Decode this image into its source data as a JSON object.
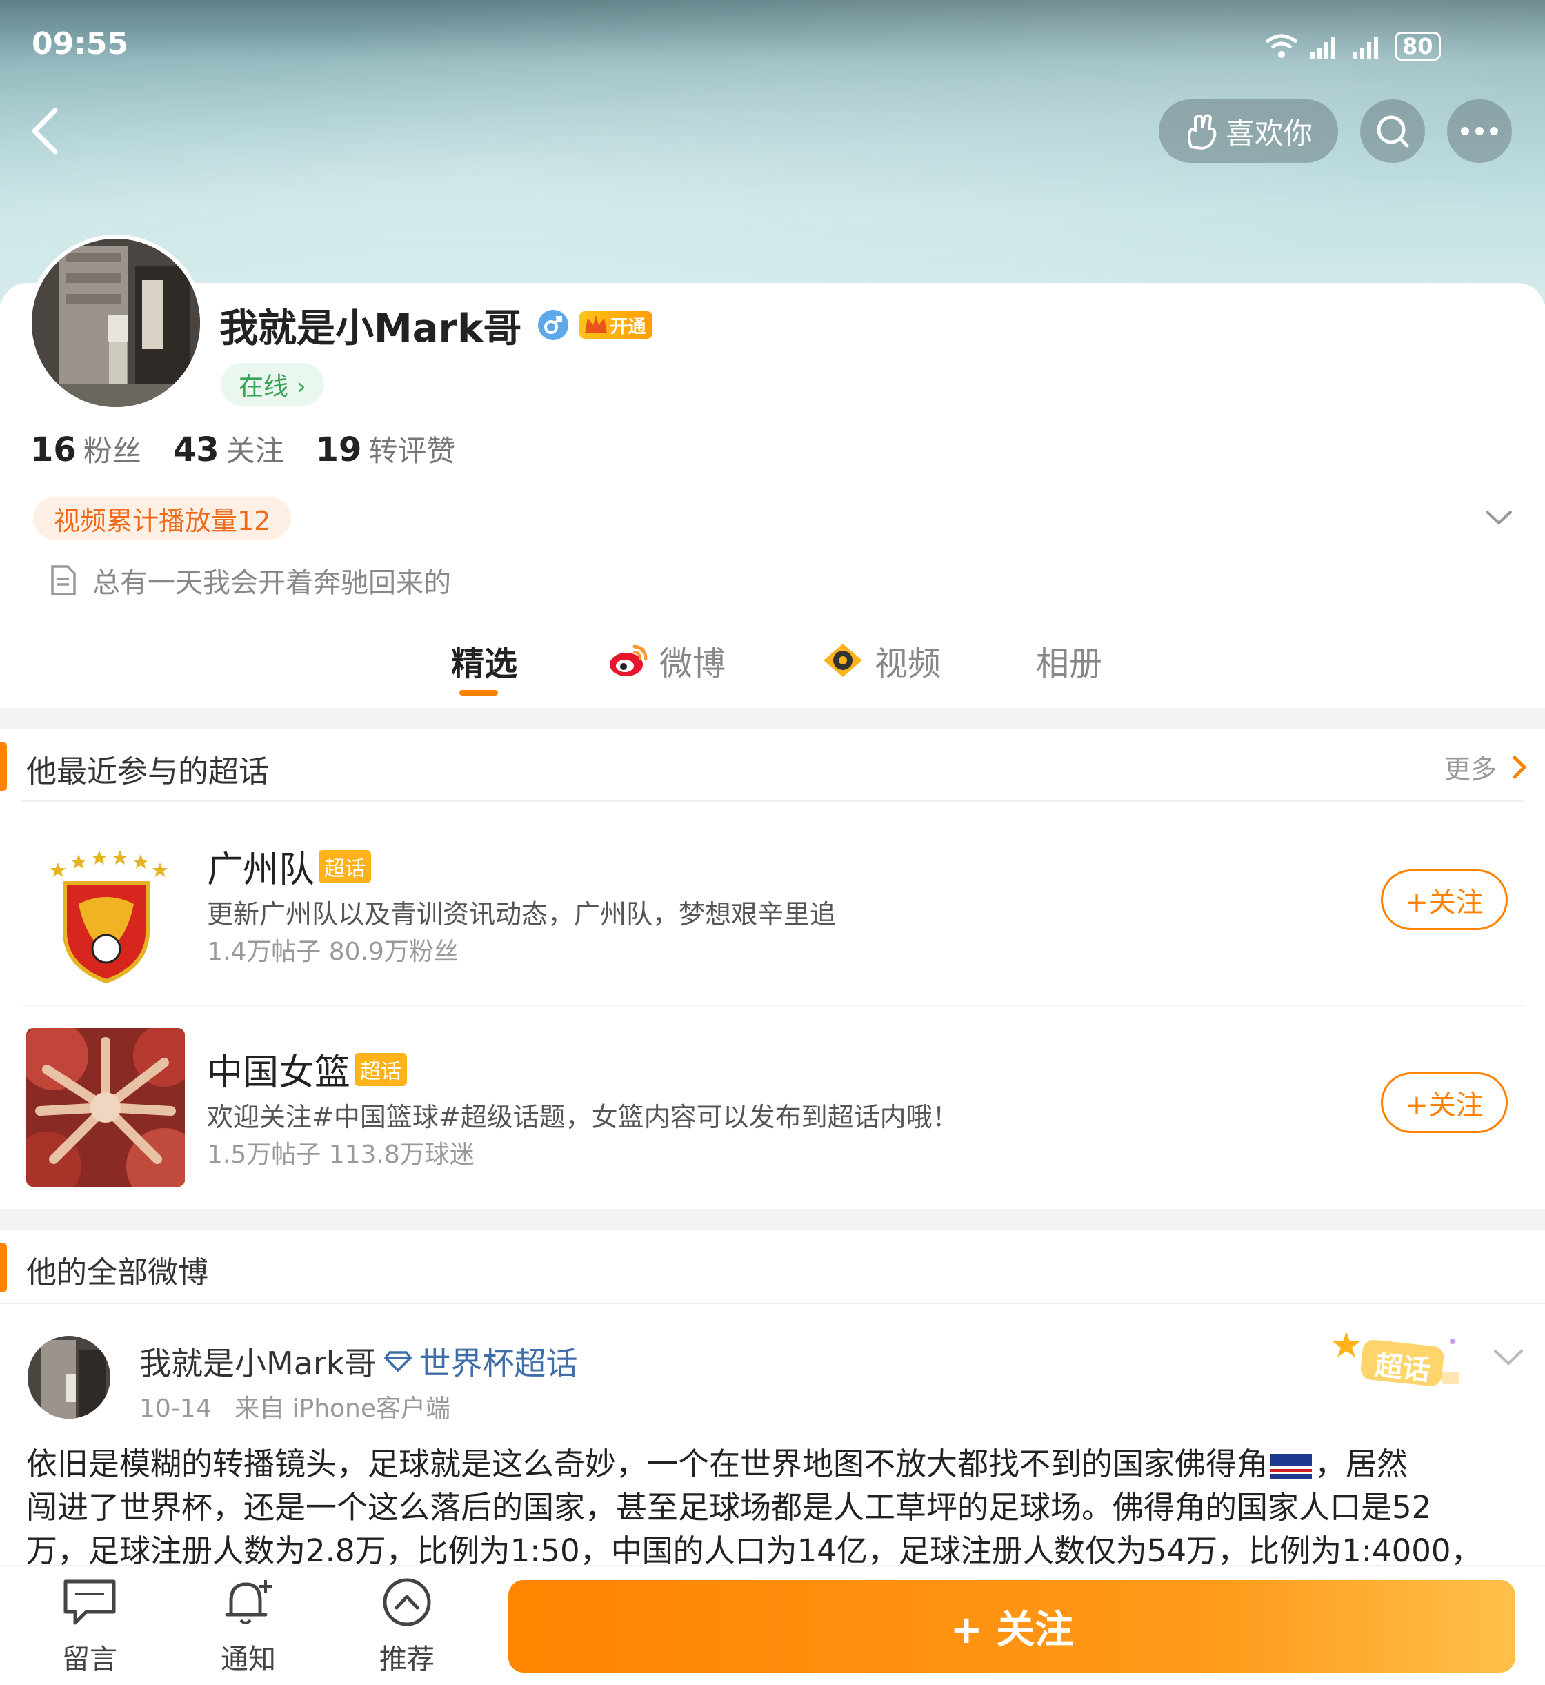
{
  "status_bar": {
    "time": "09:55",
    "battery": "80"
  },
  "header": {
    "like_label": "喜欢你"
  },
  "profile": {
    "name": "我就是小Mark哥",
    "vip_label": "开通",
    "online_label": "在线 ›",
    "stats": [
      {
        "value": "16",
        "label": "粉丝"
      },
      {
        "value": "43",
        "label": "关注"
      },
      {
        "value": "19",
        "label": "转评赞"
      }
    ],
    "video_badge": "视频累计播放量12",
    "bio": "总有一天我会开着奔驰回来的"
  },
  "tabs": [
    {
      "label": "精选",
      "active": true
    },
    {
      "label": "微博"
    },
    {
      "label": "视频"
    },
    {
      "label": "相册"
    }
  ],
  "topics_section": {
    "title": "他最近参与的超话",
    "more_label": "更多",
    "items": [
      {
        "name": "广州队",
        "badge": "超话",
        "desc": "更新广州队以及青训资讯动态，广州队，梦想艰辛里追",
        "meta": "1.4万帖子 80.9万粉丝",
        "follow_label": "+关注"
      },
      {
        "name": "中国女篮",
        "badge": "超话",
        "desc": "欢迎关注#中国篮球#超级话题，女篮内容可以发布到超话内哦！",
        "meta": "1.5万帖子 113.8万球迷",
        "follow_label": "+关注"
      }
    ]
  },
  "posts_section": {
    "title": "他的全部微博",
    "post": {
      "author": "我就是小Mark哥",
      "topic": "世界杯超话",
      "date": "10-14",
      "source": "来自 iPhone客户端",
      "sticker": "超话",
      "text_line1": "依旧是模糊的转播镜头，足球就是这么奇妙，一个在世界地图不放大都找不到的国家佛得角",
      "text_line1b": "，居然",
      "text_line2": "闯进了世界杯，还是一个这么落后的国家，甚至足球场都是人工草坪的足球场。佛得角的国家人口是52",
      "text_line3": "万，足球注册人数为2.8万，比例为1:50，中国的人口为14亿，足球注册人数仅为54万，比例为1:4000，"
    }
  },
  "bottom_bar": {
    "items": [
      {
        "label": "留言"
      },
      {
        "label": "通知"
      },
      {
        "label": "推荐"
      }
    ],
    "follow_label": "+ 关注"
  },
  "colors": {
    "accent": "#ff8200",
    "badge": "#ffb21a",
    "link": "#3f6ea8"
  }
}
